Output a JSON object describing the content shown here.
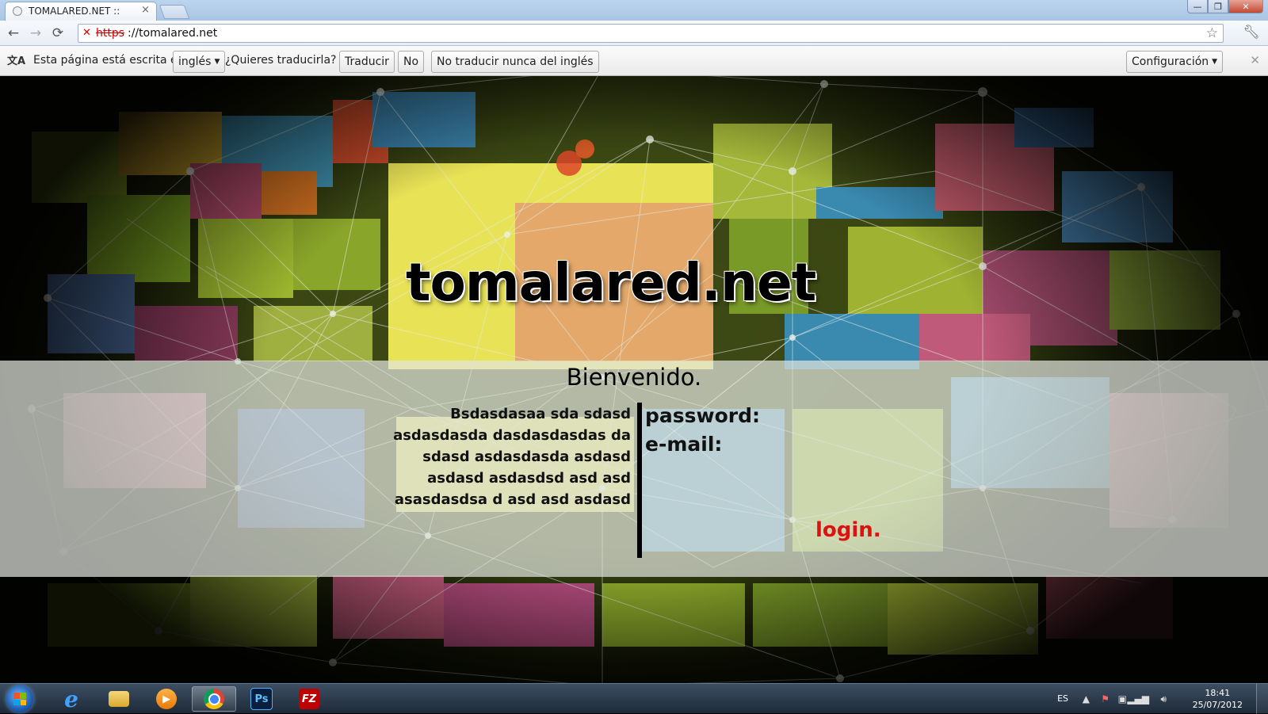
{
  "browser": {
    "tab_title": "TOMALARED.NET ::",
    "tab_close": "×",
    "url_protocol": "https",
    "url_rest": "://tomalared.net",
    "window_buttons": {
      "minimize": "—",
      "maximize": "❐",
      "close": "✕"
    }
  },
  "translate_bar": {
    "message": "Esta página está escrita en",
    "language": "inglés",
    "question": "¿Quieres traducirla?",
    "translate_button": "Traducir",
    "no_button": "No",
    "never_button": "No traducir nunca del inglés",
    "config_button": "Configuración",
    "close": "✕"
  },
  "page": {
    "logo": "tomalared.net",
    "welcome": "Bienvenido.",
    "intro_lines": [
      "Bsdasdasaa sda sdasd",
      "asdasdasda dasdasdasdas da",
      "sdasd asdasdasda asdasd",
      "asdasd asdasdsd asd asd",
      "asasdasdsa d asd asd asdasd"
    ],
    "password_label": "password:",
    "email_label": "e-mail:",
    "login_label": "login."
  },
  "taskbar": {
    "apps": [
      "internet-explorer",
      "file-explorer",
      "media-player",
      "chrome",
      "photoshop",
      "filezilla"
    ],
    "ps_label": "Ps",
    "fz_label": "FZ",
    "language": "ES",
    "time": "18:41",
    "date": "25/07/2012"
  },
  "colors": {
    "login": "#e01010",
    "overlay_band": "rgba(225,228,220,0.72)",
    "taskbar": "#1d2a38"
  }
}
